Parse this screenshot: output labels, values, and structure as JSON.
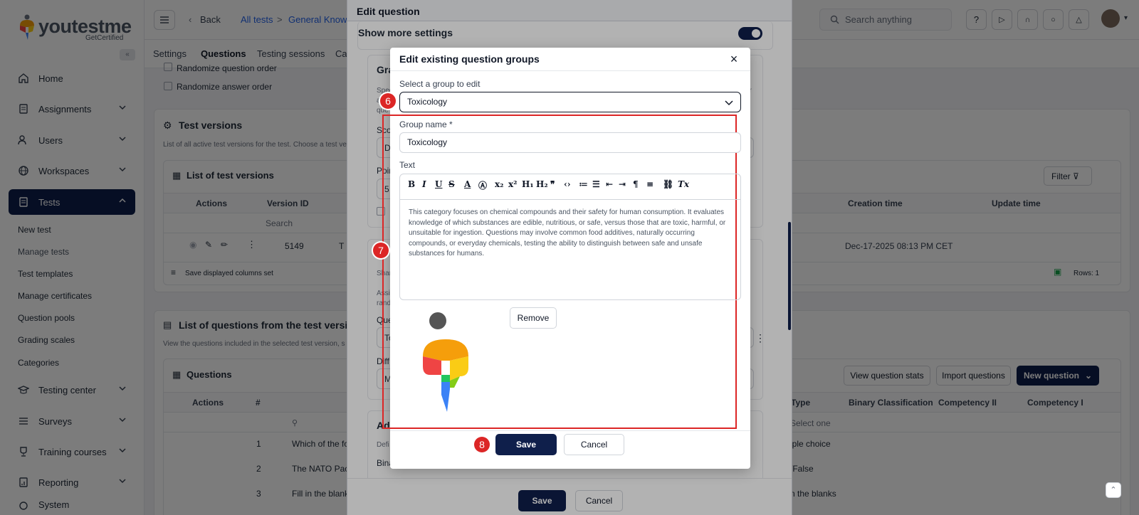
{
  "app": {
    "logo_text": "youtestme",
    "logo_sub": "GetCertified"
  },
  "sidebar": {
    "items": [
      {
        "label": "Home"
      },
      {
        "label": "Assignments"
      },
      {
        "label": "Users"
      },
      {
        "label": "Workspaces"
      },
      {
        "label": "Tests"
      },
      {
        "label": "Testing center"
      },
      {
        "label": "Surveys"
      },
      {
        "label": "Training courses"
      },
      {
        "label": "Reporting"
      },
      {
        "label": "System"
      }
    ],
    "tests_sub": [
      "New test",
      "Manage tests",
      "Test templates",
      "Manage certificates",
      "Question pools",
      "Grading scales",
      "Categories"
    ]
  },
  "topbar": {
    "back": "Back",
    "crumb1": "All tests",
    "sep": ">",
    "crumb2": "General Knowle",
    "search_placeholder": "Search anything"
  },
  "tabs": [
    "Settings",
    "Questions",
    "Testing sessions",
    "Ca"
  ],
  "background": {
    "randomize_q": "Randomize question order",
    "randomize_a": "Randomize answer order",
    "versions_title": "Test versions",
    "versions_desc": "List of all active test versions for the test. Choose a test ve",
    "list_versions_title": "List of test versions",
    "filter": "Filter",
    "col_actions": "Actions",
    "col_version": "Version ID",
    "col_creation": "Creation time",
    "col_update": "Update time",
    "search_ph": "Search",
    "version_id": "5149",
    "version_t": "T",
    "creation_value": "Dec-17-2025 08:13 PM CET",
    "save_cols": "Save displayed columns set",
    "rows": "Rows: 1",
    "questions_list_title": "List of questions from the test version \"T",
    "questions_list_desc": "View the questions included in the selected test version, s",
    "questions_title": "Questions",
    "view_stats": "View question stats",
    "import_q": "Import questions",
    "new_q": "New question",
    "qcol_actions": "Actions",
    "qcol_num": "#",
    "qcol_type": "Type",
    "qcol_binary": "Binary Classification",
    "qcol_comp2": "Competency II",
    "qcol_comp1": "Competency I",
    "select_one": "Select one",
    "rows_q": [
      {
        "num": "1",
        "text": "Which of the fo",
        "type": "iple choice"
      },
      {
        "num": "2",
        "text": "The NATO Pac",
        "type": "/False"
      },
      {
        "num": "3",
        "text": "Fill in the blank",
        "type": "n the blanks"
      }
    ]
  },
  "outer_modal": {
    "title": "Edit question",
    "show_more": "Show more settings",
    "grading_prefix": "Gra",
    "spec": "Spec",
    "a": "a",
    "que": "que",
    "sco": "Sco",
    "d": "D",
    "poin": "Poin",
    "five": "5",
    "shar": "Shar",
    "assi": "Assi",
    "rand": "rand",
    "er": "er",
    "que2": "Que",
    "to": "To",
    "diff": "Diff",
    "m": "M",
    "add": "Add",
    "defi": "Defi",
    "bina": "Bina",
    "save": "Save",
    "cancel": "Cancel"
  },
  "inner_modal": {
    "title": "Edit existing question groups",
    "select_label": "Select a group to edit",
    "select_value": "Toxicology",
    "group_name_label": "Group name",
    "required": "*",
    "group_name_value": "Toxicology",
    "text_label": "Text",
    "editor_text": "This category focuses on chemical compounds and their safety for human consumption. It evaluates knowledge of which substances are edible, nutritious, or safe, versus those that are toxic, harmful, or unsuitable for ingestion. Questions may involve common food additives, naturally occurring compounds, or everyday chemicals, testing the ability to distinguish between safe and unsafe substances for humans.",
    "remove": "Remove",
    "save": "Save",
    "cancel": "Cancel"
  },
  "steps": {
    "s6": "6",
    "s7": "7",
    "s8": "8"
  },
  "colors": {
    "navy": "#0f1f4b",
    "red": "#dc2626",
    "accent": "#2563eb"
  }
}
